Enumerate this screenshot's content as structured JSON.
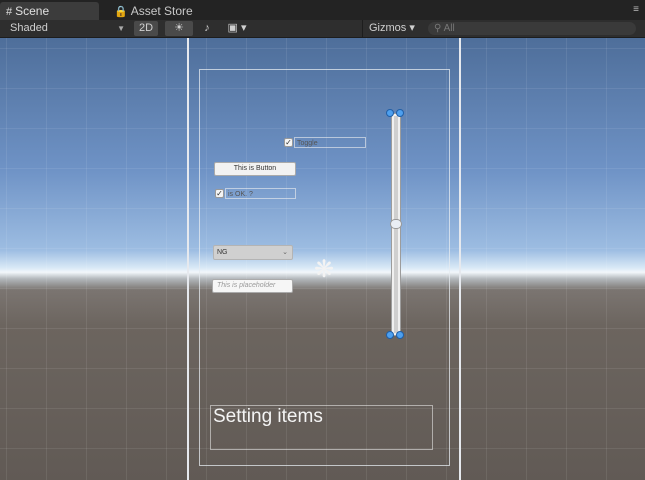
{
  "tabs": [
    {
      "label": "Scene",
      "icon": "grid-icon",
      "active": true
    },
    {
      "label": "Asset Store",
      "icon": "lock-icon",
      "active": false
    }
  ],
  "toolbar": {
    "draw_mode": "Shaded",
    "mode_2d": "2D",
    "gizmos_label": "Gizmos",
    "search_placeholder": "All",
    "sun_icon": "sun-icon",
    "audio_icon": "audio-icon",
    "image_icon": "image-effects-icon"
  },
  "scene": {
    "toggle1_label": "Toggle",
    "button_label": "This is Button",
    "toggle2_label": "is OK. ?",
    "dropdown_value": "NG",
    "input_placeholder": "This is placeholder",
    "slider_value": 0.5,
    "text_label": "Setting items"
  },
  "colors": {
    "gizmo_handle": "#4ea0ef",
    "selection_outline": "#e6e9ee"
  }
}
